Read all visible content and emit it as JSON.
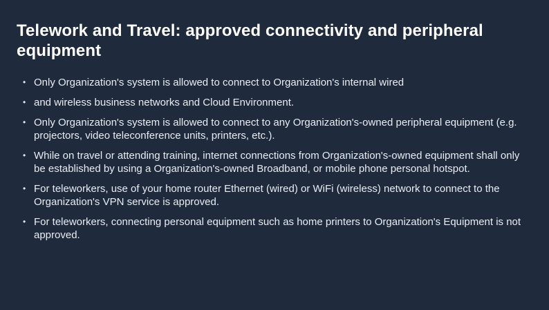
{
  "slide": {
    "title": "Telework and Travel: approved connectivity and peripheral equipment",
    "bullet_glyph": "•",
    "bullets": [
      "Only Organization's system is allowed to connect to Organization's internal wired",
      "and wireless business networks and Cloud Environment.",
      "Only Organization's system is allowed to connect to any Organization's-owned  peripheral equipment (e.g. projectors, video teleconference units, printers, etc.).",
      "While on travel or attending training, internet connections from Organization's-owned equipment shall  only be established by using a Organization's-owned Broadband, or mobile phone personal hotspot.",
      "For teleworkers, use of your home router Ethernet (wired) or WiFi (wireless) network to connect to the Organization's VPN service is approved.",
      "For teleworkers, connecting personal equipment such as home printers to Organization's Equipment is not approved."
    ]
  },
  "colors": {
    "background": "#1f2a3d",
    "title": "#ffffff",
    "text": "#e9edf3"
  }
}
